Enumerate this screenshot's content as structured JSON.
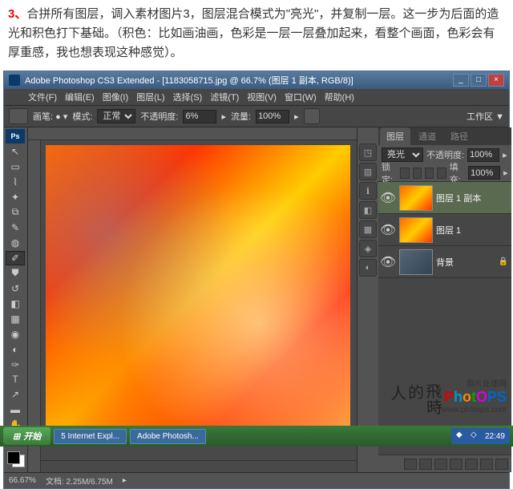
{
  "instruction": {
    "num": "3、",
    "text1": "合拼所有图层，调入素材图片3，图层混合模式为\"亮光\"，并复制一层。这一步为后面的造光和积色打下基础。（积色：比如画油画，色彩是一层一层叠加起来，看整个画面，色彩会有厚重感，我也想表现这种感觉）。"
  },
  "titlebar": {
    "app": "Adobe Photoshop CS3 Extended",
    "doc": "[1183058715.jpg @ 66.7% (图层 1 副本, RGB/8)]"
  },
  "menu": [
    "文件(F)",
    "编辑(E)",
    "图像(I)",
    "图层(L)",
    "选择(S)",
    "滤镜(T)",
    "视图(V)",
    "窗口(W)",
    "帮助(H)"
  ],
  "options": {
    "mode_label": "模式:",
    "mode_value": "正常",
    "opacity_label": "不透明度:",
    "opacity_value": "6%",
    "flow_label": "流量:",
    "flow_value": "100%",
    "workspace_label": "工作区 ▼"
  },
  "layers_panel": {
    "tabs": [
      "图层",
      "通道",
      "路径"
    ],
    "blend_mode": "亮光",
    "opacity_label": "不透明度:",
    "opacity_value": "100%",
    "lock_label": "锁定:",
    "fill_label": "填充:",
    "fill_value": "100%",
    "layers": [
      {
        "name": "图层 1 副本",
        "selected": true
      },
      {
        "name": "图层 1",
        "selected": false
      },
      {
        "name": "背景",
        "selected": false,
        "locked": true
      }
    ]
  },
  "status": {
    "zoom": "66.67%",
    "doc": "文档: 2.25M/6.75M"
  },
  "watermark": {
    "site": "照片处理网",
    "url": "www.photops.com"
  },
  "taskbar": {
    "start": "开始",
    "items": [
      "5 Internet Expl...",
      "Adobe Photosh..."
    ],
    "time": "22:49"
  }
}
